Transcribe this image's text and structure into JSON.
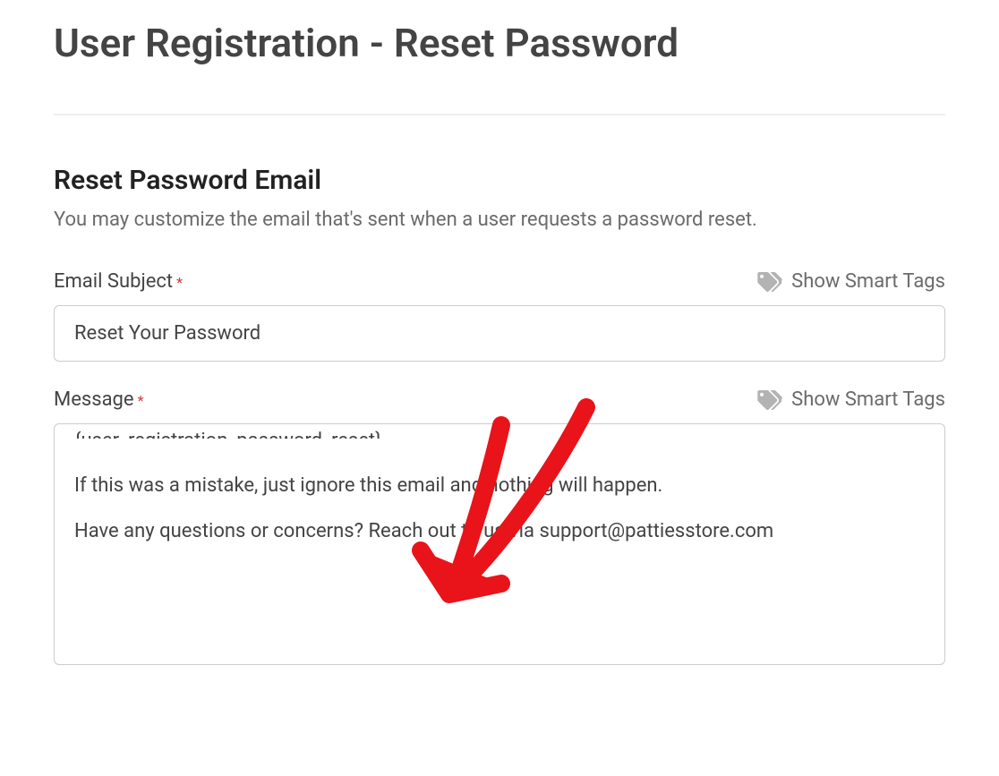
{
  "header": {
    "title": "User Registration - Reset Password"
  },
  "section": {
    "title": "Reset Password Email",
    "description": "You may customize the email that's sent when a user requests a password reset."
  },
  "smart_tags_label": "Show Smart Tags",
  "subject": {
    "label": "Email Subject",
    "required": "*",
    "value": "Reset Your Password"
  },
  "message": {
    "label": "Message",
    "required": "*",
    "placeholder_tag": "{user_registration_password_reset}",
    "line1": "If this was a mistake, just ignore this email and nothing will happen.",
    "line2": "Have any questions or concerns? Reach out to us via support@pattiesstore.com"
  }
}
